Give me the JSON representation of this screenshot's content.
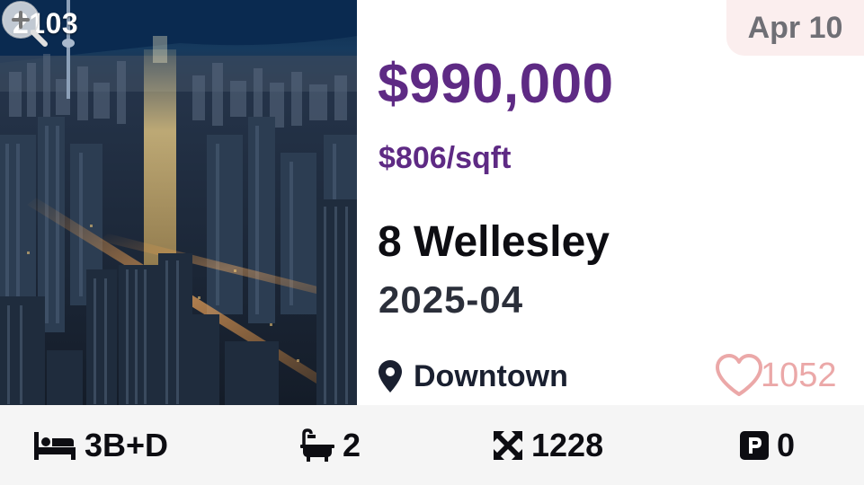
{
  "listing": {
    "unit": "2103",
    "date": "Apr 10",
    "price": "$990,000",
    "price_per_sqft": "$806/sqft",
    "name": "8 Wellesley",
    "occupancy": "2025-04",
    "location": "Downtown",
    "likes": "1052",
    "image_icon": "zoom-in-icon"
  },
  "specs": {
    "bedrooms": "3B+D",
    "bathrooms": "2",
    "size": "1228",
    "parking": "0"
  },
  "icons": {
    "bed": "bed-icon",
    "bath": "bathtub-icon",
    "size": "expand-arrows-icon",
    "parking": "parking-icon",
    "location": "map-pin-icon",
    "likes": "heart-outline-icon"
  },
  "colors": {
    "price": "#5e2a84",
    "date_badge_bg": "#fbeeee",
    "heart": "#eba8a8",
    "specs_bar_bg": "#f5f5f5"
  }
}
